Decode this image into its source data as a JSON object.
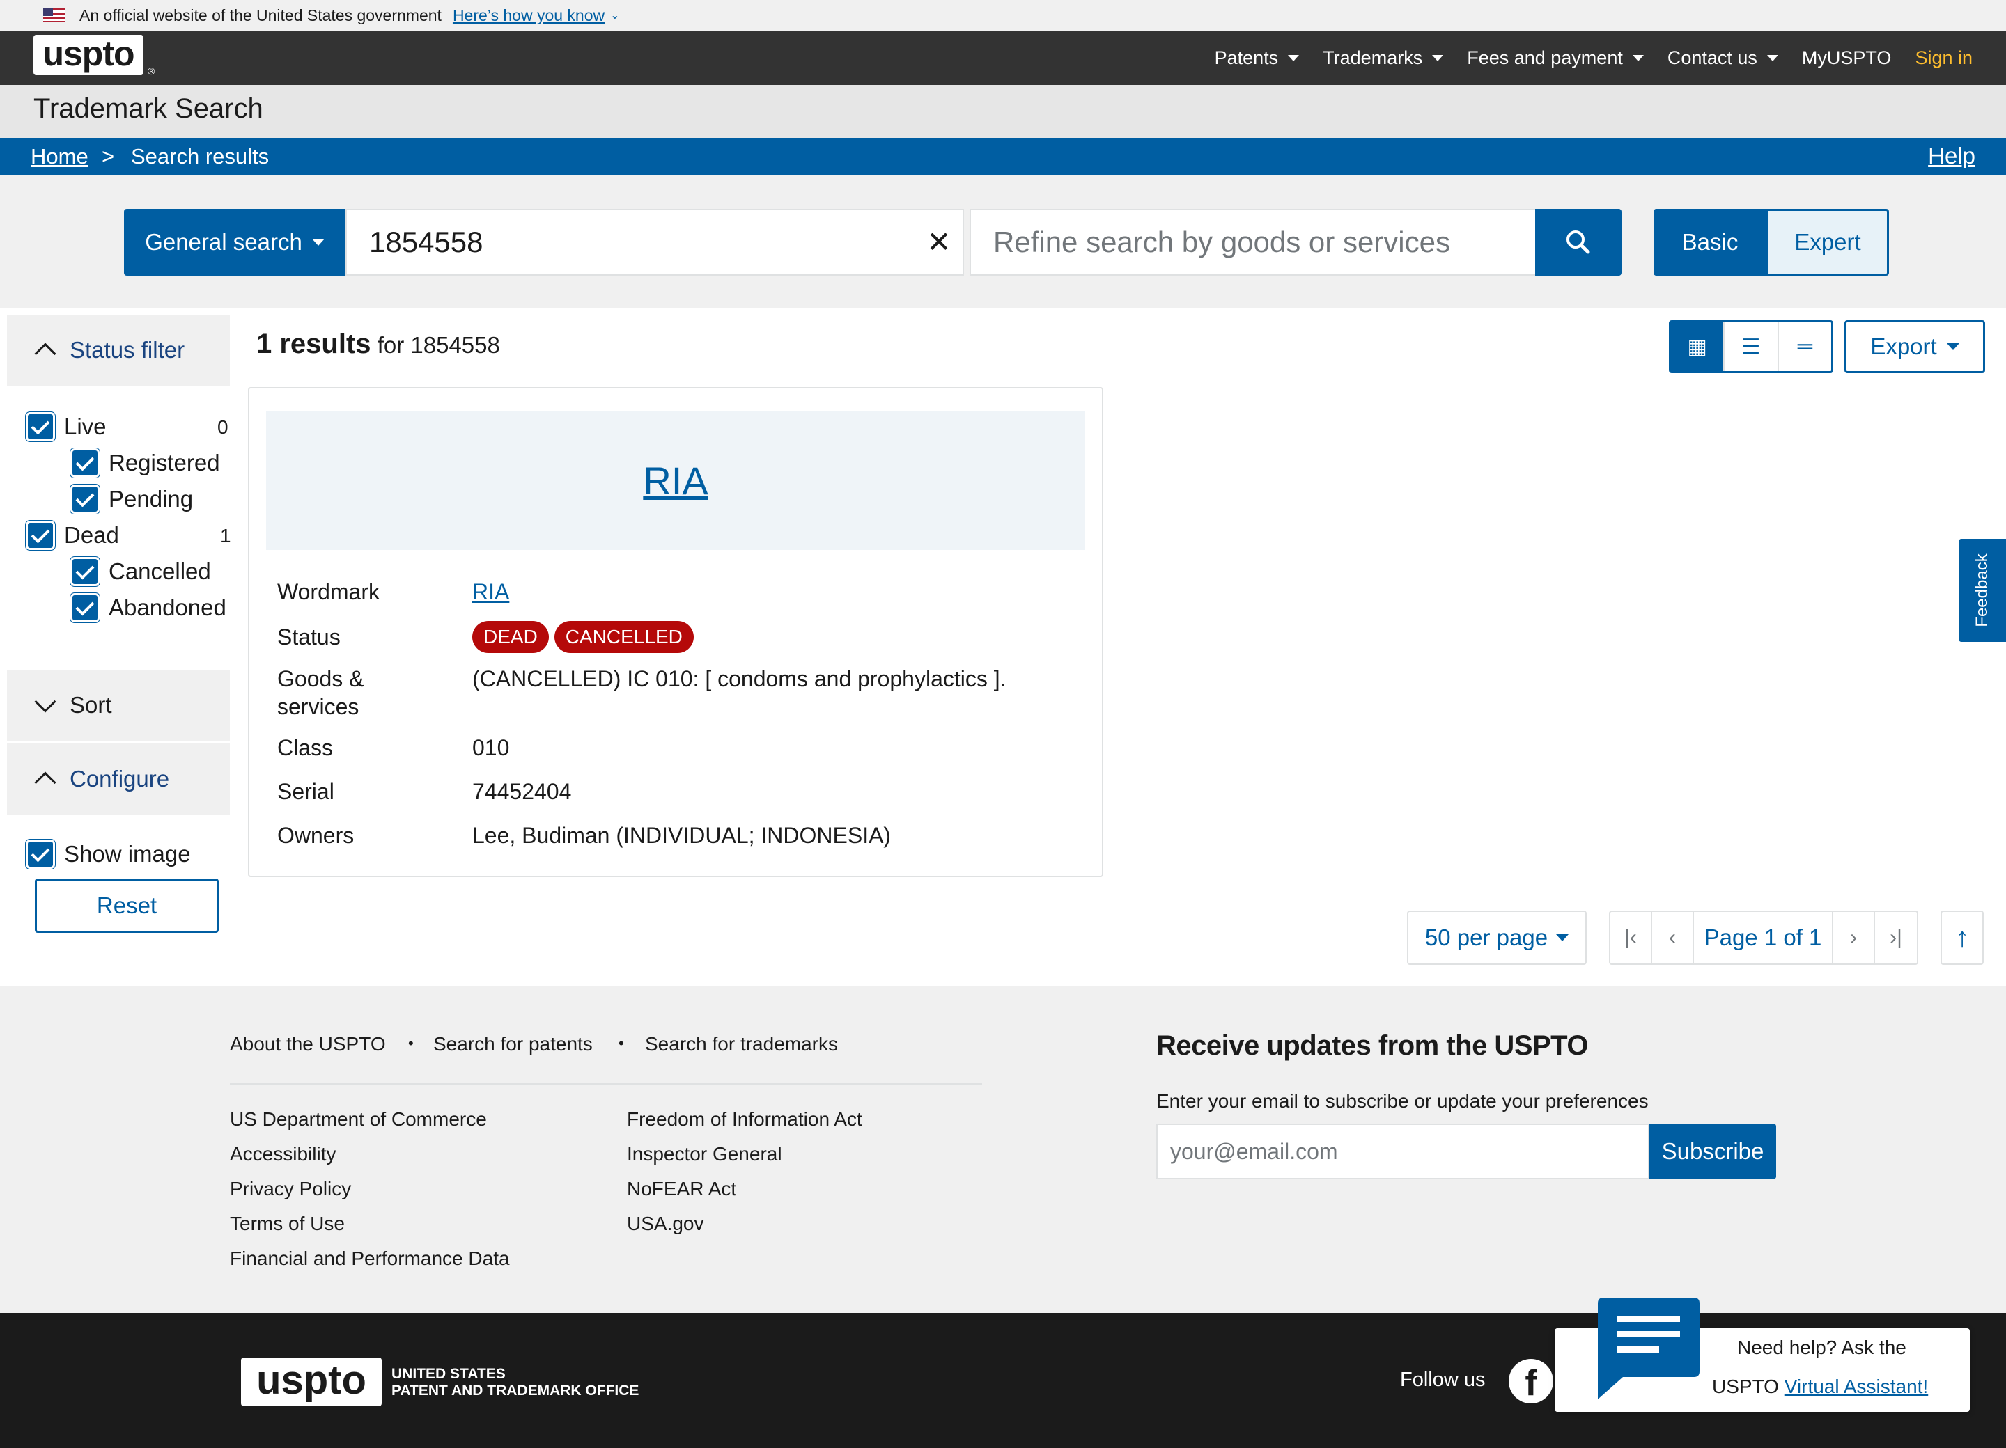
{
  "gov_banner": {
    "text": "An official website of the United States government",
    "link": "Here’s how you know"
  },
  "header": {
    "logo": "uspto",
    "nav": [
      "Patents",
      "Trademarks",
      "Fees and payment",
      "Contact us"
    ],
    "my_uspto": "MyUSPTO",
    "sign_in": "Sign in"
  },
  "page_title": "Trademark Search",
  "breadcrumb": {
    "home": "Home",
    "separator": ">",
    "current": "Search results",
    "help": "Help"
  },
  "search": {
    "type_label": "General search",
    "query": "1854558",
    "refine_placeholder": "Refine search by goods or services",
    "mode_basic": "Basic",
    "mode_expert": "Expert"
  },
  "sidebar": {
    "status_filter": "Status filter",
    "live": {
      "label": "Live",
      "count": "0"
    },
    "registered": "Registered",
    "pending": "Pending",
    "dead": {
      "label": "Dead",
      "count": "1"
    },
    "cancelled": "Cancelled",
    "abandoned": "Abandoned",
    "sort": "Sort",
    "configure": "Configure",
    "show_image": "Show image",
    "reset": "Reset"
  },
  "results": {
    "count": "1 results",
    "for_text": "for 1854558",
    "export": "Export"
  },
  "card": {
    "title": "RIA",
    "fields": {
      "wordmark_label": "Wordmark",
      "wordmark_value": "RIA",
      "status_label": "Status",
      "status_badges": [
        "DEAD",
        "CANCELLED"
      ],
      "goods_label_1": "Goods &",
      "goods_label_2": "services",
      "goods_value": "(CANCELLED) IC 010: [ condoms and prophylactics ].",
      "class_label": "Class",
      "class_value": "010",
      "serial_label": "Serial",
      "serial_value": "74452404",
      "owners_label": "Owners",
      "owners_value": "Lee, Budiman (INDIVIDUAL; INDONESIA)"
    }
  },
  "pagination": {
    "per_page": "50 per page",
    "page_label": "Page 1 of 1"
  },
  "feedback": "Feedback",
  "footer": {
    "top_links": [
      "About the USPTO",
      "Search for patents",
      "Search for trademarks"
    ],
    "col1": [
      "US Department of Commerce",
      "Accessibility",
      "Privacy Policy",
      "Terms of Use",
      "Financial and Performance Data"
    ],
    "col2": [
      "Freedom of Information Act",
      "Inspector General",
      "NoFEAR Act",
      "USA.gov"
    ],
    "updates_title": "Receive updates from the USPTO",
    "updates_sub": "Enter your email to subscribe or update your preferences",
    "email_placeholder": "your@email.com",
    "subscribe": "Subscribe",
    "agency_line1": "UNITED STATES",
    "agency_line2": "PATENT AND TRADEMARK OFFICE",
    "follow_us": "Follow us",
    "va_line1": "Need help? Ask the",
    "va_prefix": "USPTO",
    "va_link": "Virtual Assistant!"
  },
  "colors": {
    "primary": "#005ea2",
    "dark_nav": "#333333",
    "badge_red": "#b50909",
    "sign_in_gold": "#ffbe2e"
  }
}
